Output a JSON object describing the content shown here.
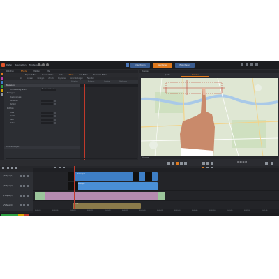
{
  "titlebar": {
    "menus": [
      "Datei",
      "Bearbeiten",
      "Einstellungen"
    ],
    "mode_tabs": [
      {
        "label": "Importieren",
        "active": false
      },
      {
        "label": "Bearbeiten",
        "active": true
      },
      {
        "label": "Exportieren",
        "active": false
      }
    ]
  },
  "left_panel": {
    "tabs": [
      {
        "label": "Bibliothek",
        "active": false
      },
      {
        "label": "Effekte",
        "active": true
      },
      {
        "label": "Medien",
        "active": false
      },
      {
        "label": "Titel",
        "active": false
      }
    ],
    "sub_tabs": [
      {
        "label": "Eigenschaften",
        "active": false
      },
      {
        "label": "Medien-Editor",
        "active": false
      },
      {
        "label": "Farbe",
        "active": false
      },
      {
        "label": "Effekt",
        "active": true
      },
      {
        "label": "Geh-Editor",
        "active": false
      },
      {
        "label": "Panorama Editor",
        "active": false
      }
    ],
    "tool_tabs": [
      "Alle",
      "Kopieren",
      "Einfügen",
      "Zuruck",
      "Keyframes",
      "Voreinstellungen",
      "Favoriten"
    ],
    "strip_labels": [
      "Zeitachse",
      "Keyframe",
      "Position",
      "Skalierung"
    ],
    "properties": {
      "header": "Bewegung",
      "rows": [
        {
          "label": "Voreinstellung laden",
          "value": "Benutzerdefiniert"
        },
        {
          "label": "Bewegung",
          "value": ""
        },
        {
          "label": "Positionierung",
          "value": ""
        },
        {
          "label": "Horizontal",
          "value": ""
        },
        {
          "label": "Vertikal",
          "value": ""
        },
        {
          "label": "Rotation",
          "value": ""
        },
        {
          "label": "Links",
          "value": ""
        },
        {
          "label": "Rechts",
          "value": ""
        },
        {
          "label": "Oben",
          "value": ""
        },
        {
          "label": "Unten",
          "value": ""
        }
      ],
      "footer": "Voreinstellungen"
    }
  },
  "preview": {
    "title": "Vorschau",
    "tabs": [
      {
        "label": "Quelle",
        "active": false
      },
      {
        "label": "Timeline",
        "active": true
      }
    ],
    "info": "Vorschau",
    "timecode": "00:00:12:08"
  },
  "timeline": {
    "timecode": "00:00:12:08",
    "tracks": [
      {
        "name": "A/V Spur (1)"
      },
      {
        "name": "A/V Spur (2)"
      },
      {
        "name": "A/V Spur (3)"
      },
      {
        "name": "A/V Spur (4)"
      }
    ],
    "clips": [
      {
        "label": "Videoclip 1"
      },
      {
        "label": "Karte.mp4"
      },
      {
        "label": "Musik"
      }
    ],
    "ticks": [
      "00:00:00",
      "00:00:05",
      "00:00:10",
      "00:00:15",
      "00:00:20",
      "00:00:25",
      "00:00:30",
      "00:00:35",
      "00:00:40",
      "00:00:45",
      "00:00:50",
      "00:00:55",
      "00:01:00",
      "00:01:05"
    ]
  },
  "colors": {
    "accent": "#e07a1e",
    "tab_blue": "#3a5c8f",
    "clip_blue": "#3e7fc6",
    "clip_pink": "#b58bb0",
    "playhead": "#c0392b",
    "map_water": "#a9c9e8",
    "map_land": "#dfe7d3"
  },
  "icons": [
    "app-logo-icon",
    "home-icon",
    "play-icon",
    "hand-icon",
    "gear-icon"
  ]
}
